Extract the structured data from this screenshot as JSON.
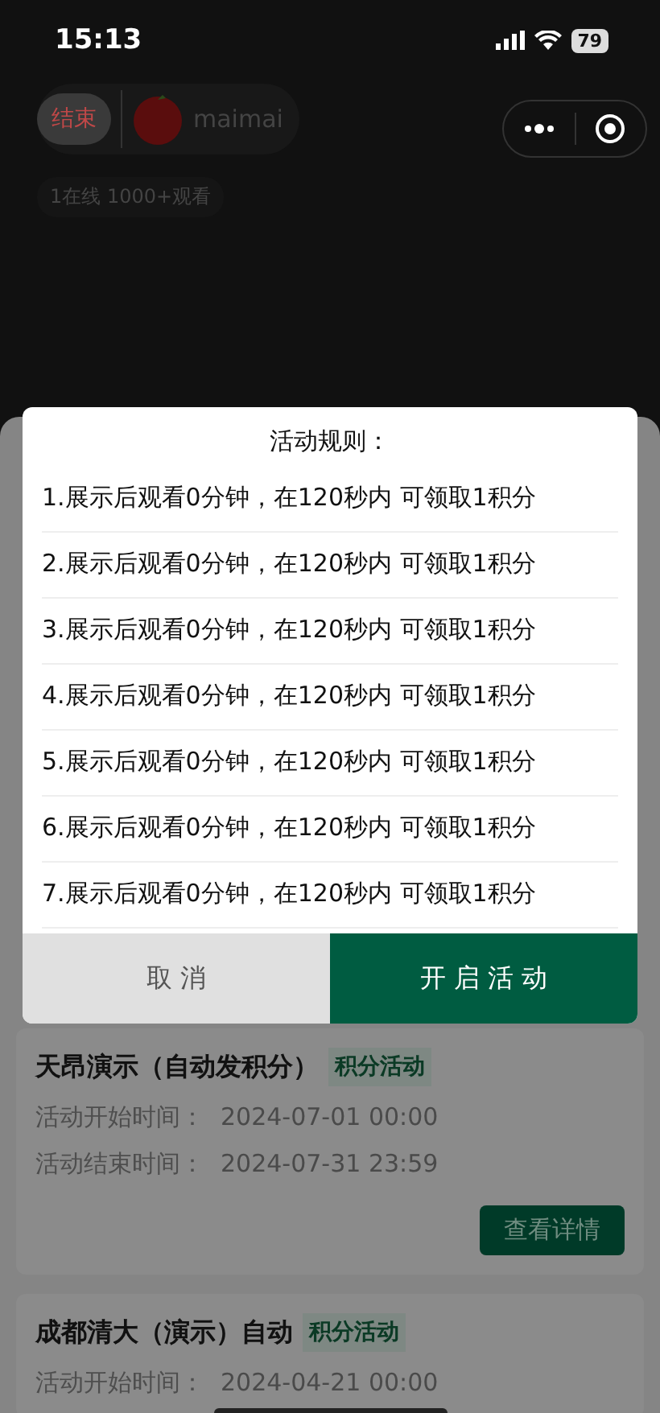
{
  "status_bar": {
    "time": "15:13",
    "battery": "79"
  },
  "host": {
    "end_label": "结束",
    "name": "maimai",
    "stats": "1在线  1000+观看"
  },
  "dialog": {
    "title": "活动规则：",
    "rules": [
      "1.展示后观看0分钟，在120秒内 可领取1积分",
      "2.展示后观看0分钟，在120秒内 可领取1积分",
      "3.展示后观看0分钟，在120秒内 可领取1积分",
      "4.展示后观看0分钟，在120秒内 可领取1积分",
      "5.展示后观看0分钟，在120秒内 可领取1积分",
      "6.展示后观看0分钟，在120秒内 可领取1积分",
      "7.展示后观看0分钟，在120秒内 可领取1积分"
    ],
    "cancel": "取 消",
    "confirm": "开 启 活 动"
  },
  "activities": [
    {
      "title": "天昂演示（自动发积分）",
      "tag": "积分活动",
      "rows": [
        {
          "label": "活动开始时间：",
          "value": "2024-07-01 00:00"
        },
        {
          "label": "活动结束时间：",
          "value": "2024-07-31 23:59"
        }
      ],
      "button": "查看详情"
    },
    {
      "title": "成都清大（演示）自动",
      "tag": "积分活动",
      "rows": [
        {
          "label": "活动开始时间：",
          "value": "2024-04-21 00:00"
        }
      ]
    }
  ]
}
